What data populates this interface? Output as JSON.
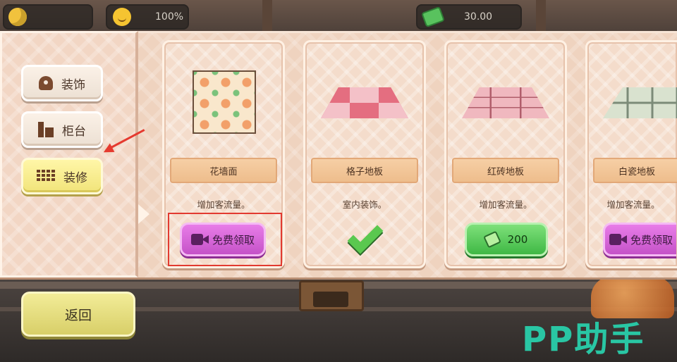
{
  "hud": {
    "day_text": "",
    "mood_value": "100%",
    "money_value": "30.00"
  },
  "sidebar": {
    "items": [
      {
        "label": "装饰",
        "icon": "flower-icon"
      },
      {
        "label": "柜台",
        "icon": "counter-icon"
      },
      {
        "label": "装修",
        "icon": "bricks-icon",
        "active": true
      }
    ]
  },
  "cards": [
    {
      "name": "花墙面",
      "desc": "增加客流量。",
      "action": "免费领取",
      "preview": "flower-wall"
    },
    {
      "name": "格子地板",
      "desc": "室内装饰。",
      "action": "owned",
      "preview": "checker-floor"
    },
    {
      "name": "红砖地板",
      "desc": "增加客流量。",
      "action": "200",
      "preview": "red-brick-floor"
    },
    {
      "name": "白瓷地板",
      "desc": "增加客流量。",
      "action": "免费领取",
      "preview": "white-tile-floor"
    }
  ],
  "back_label": "返回",
  "logo_text": "PP助手",
  "colors": {
    "panel": "#efd3bf",
    "free_button": "#d866d9",
    "buy_button": "#4fc553",
    "active_tab": "#f4e886",
    "highlight_red": "#e23a30",
    "logo": "#29c6a4"
  }
}
